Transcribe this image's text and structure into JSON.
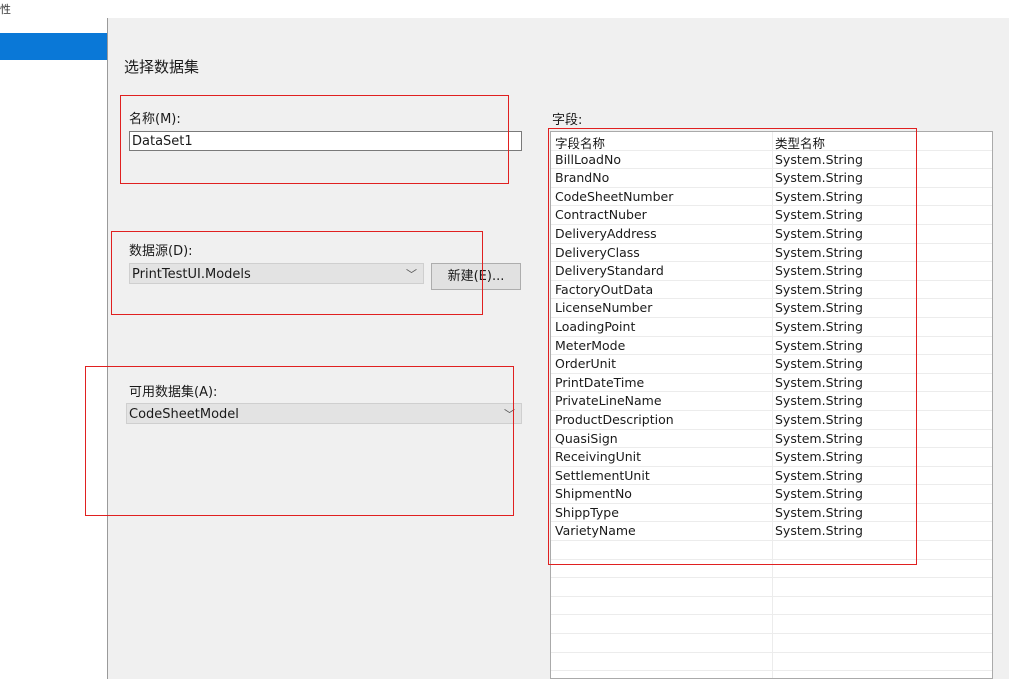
{
  "window": {
    "title": "性"
  },
  "page": {
    "title": "选择数据集"
  },
  "name_section": {
    "label": "名称(M):",
    "value": "DataSet1"
  },
  "datasource_section": {
    "label": "数据源(D):",
    "selected": "PrintTestUI.Models",
    "new_button": "新建(E)..."
  },
  "available_section": {
    "label": "可用数据集(A):",
    "selected": "CodeSheetModel"
  },
  "fields": {
    "label": "字段:",
    "headers": [
      "字段名称",
      "类型名称"
    ],
    "rows": [
      [
        "BillLoadNo",
        "System.String"
      ],
      [
        "BrandNo",
        "System.String"
      ],
      [
        "CodeSheetNumber",
        "System.String"
      ],
      [
        "ContractNuber",
        "System.String"
      ],
      [
        "DeliveryAddress",
        "System.String"
      ],
      [
        "DeliveryClass",
        "System.String"
      ],
      [
        "DeliveryStandard",
        "System.String"
      ],
      [
        "FactoryOutData",
        "System.String"
      ],
      [
        "LicenseNumber",
        "System.String"
      ],
      [
        "LoadingPoint",
        "System.String"
      ],
      [
        "MeterMode",
        "System.String"
      ],
      [
        "OrderUnit",
        "System.String"
      ],
      [
        "PrintDateTime",
        "System.String"
      ],
      [
        "PrivateLineName",
        "System.String"
      ],
      [
        "ProductDescription",
        "System.String"
      ],
      [
        "QuasiSign",
        "System.String"
      ],
      [
        "ReceivingUnit",
        "System.String"
      ],
      [
        "SettlementUnit",
        "System.String"
      ],
      [
        "ShipmentNo",
        "System.String"
      ],
      [
        "ShippType",
        "System.String"
      ],
      [
        "VarietyName",
        "System.String"
      ]
    ]
  },
  "colors": {
    "selection": "#0a78d7",
    "highlight_box": "#e02020"
  }
}
